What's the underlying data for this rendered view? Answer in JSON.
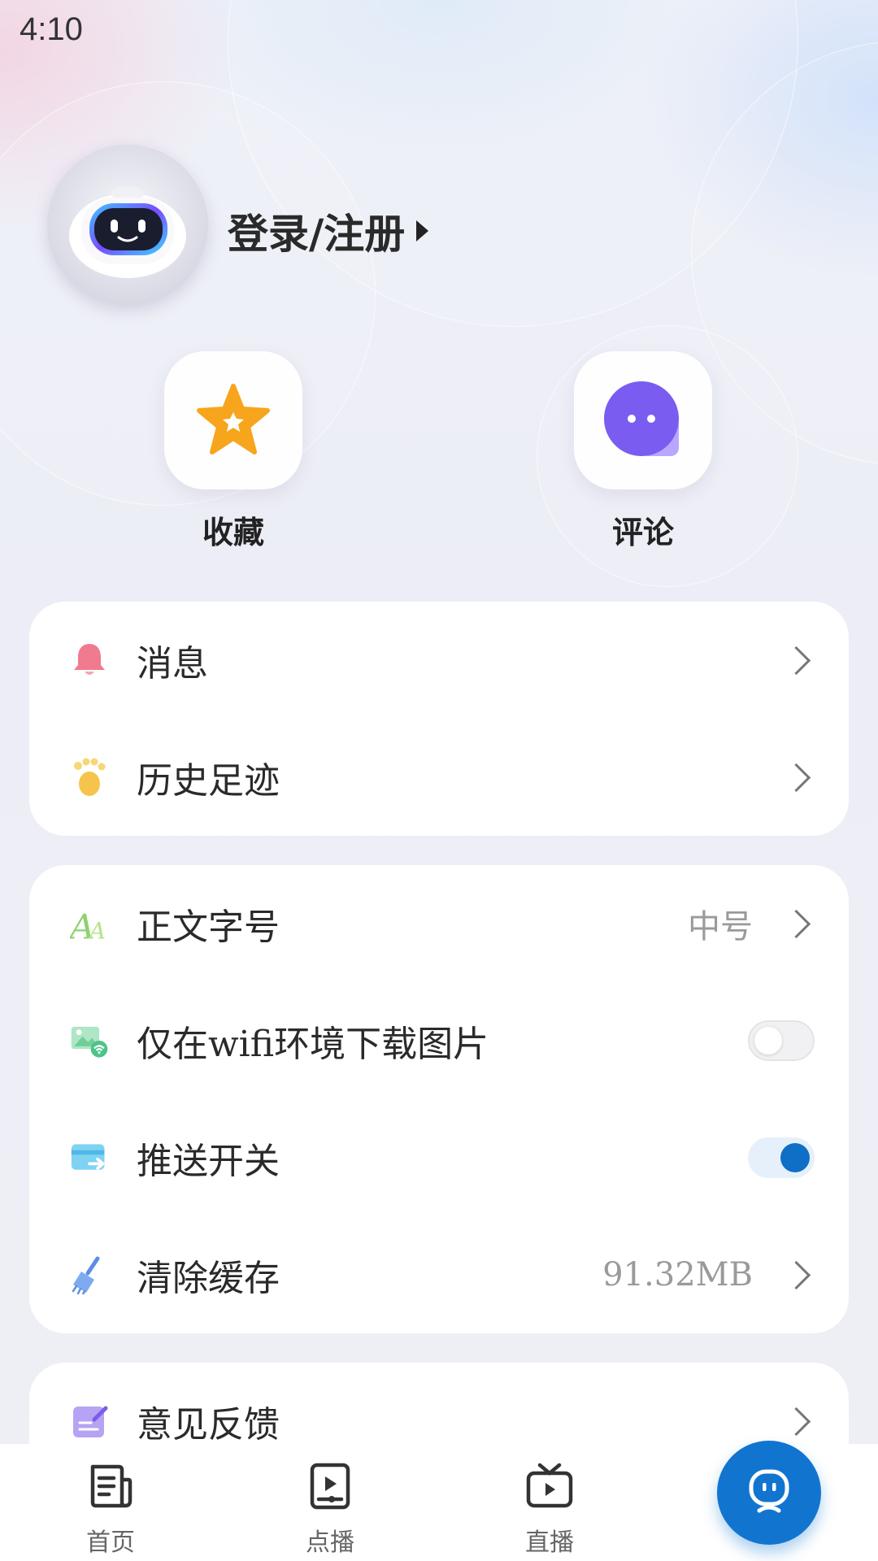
{
  "status_bar": {
    "time": "4:10"
  },
  "profile": {
    "login_label": "登录/注册"
  },
  "quick_actions": [
    {
      "label": "收藏",
      "icon": "star-icon"
    },
    {
      "label": "评论",
      "icon": "comment-bubble-icon"
    }
  ],
  "group1": [
    {
      "label": "消息",
      "icon": "bell-icon"
    },
    {
      "label": "历史足迹",
      "icon": "footprint-icon"
    }
  ],
  "group2": [
    {
      "label": "正文字号",
      "value": "中号",
      "icon": "font-size-icon"
    },
    {
      "label": "仅在wifi环境下载图片",
      "toggle": false,
      "icon": "wifi-image-icon"
    },
    {
      "label": "推送开关",
      "toggle": true,
      "icon": "push-icon"
    },
    {
      "label": "清除缓存",
      "value": "91.32MB",
      "icon": "broom-icon"
    }
  ],
  "group3": [
    {
      "label": "意见反馈",
      "icon": "feedback-icon"
    }
  ],
  "tabbar": [
    {
      "label": "首页",
      "icon": "news-icon"
    },
    {
      "label": "点播",
      "icon": "video-on-demand-icon"
    },
    {
      "label": "直播",
      "icon": "tv-live-icon"
    },
    {
      "label": "",
      "icon": "robot-assistant-icon"
    }
  ],
  "colors": {
    "accent": "#1175d0",
    "star": "#f7a51c",
    "comment": "#7a5cf0",
    "bell": "#f07a8e"
  }
}
